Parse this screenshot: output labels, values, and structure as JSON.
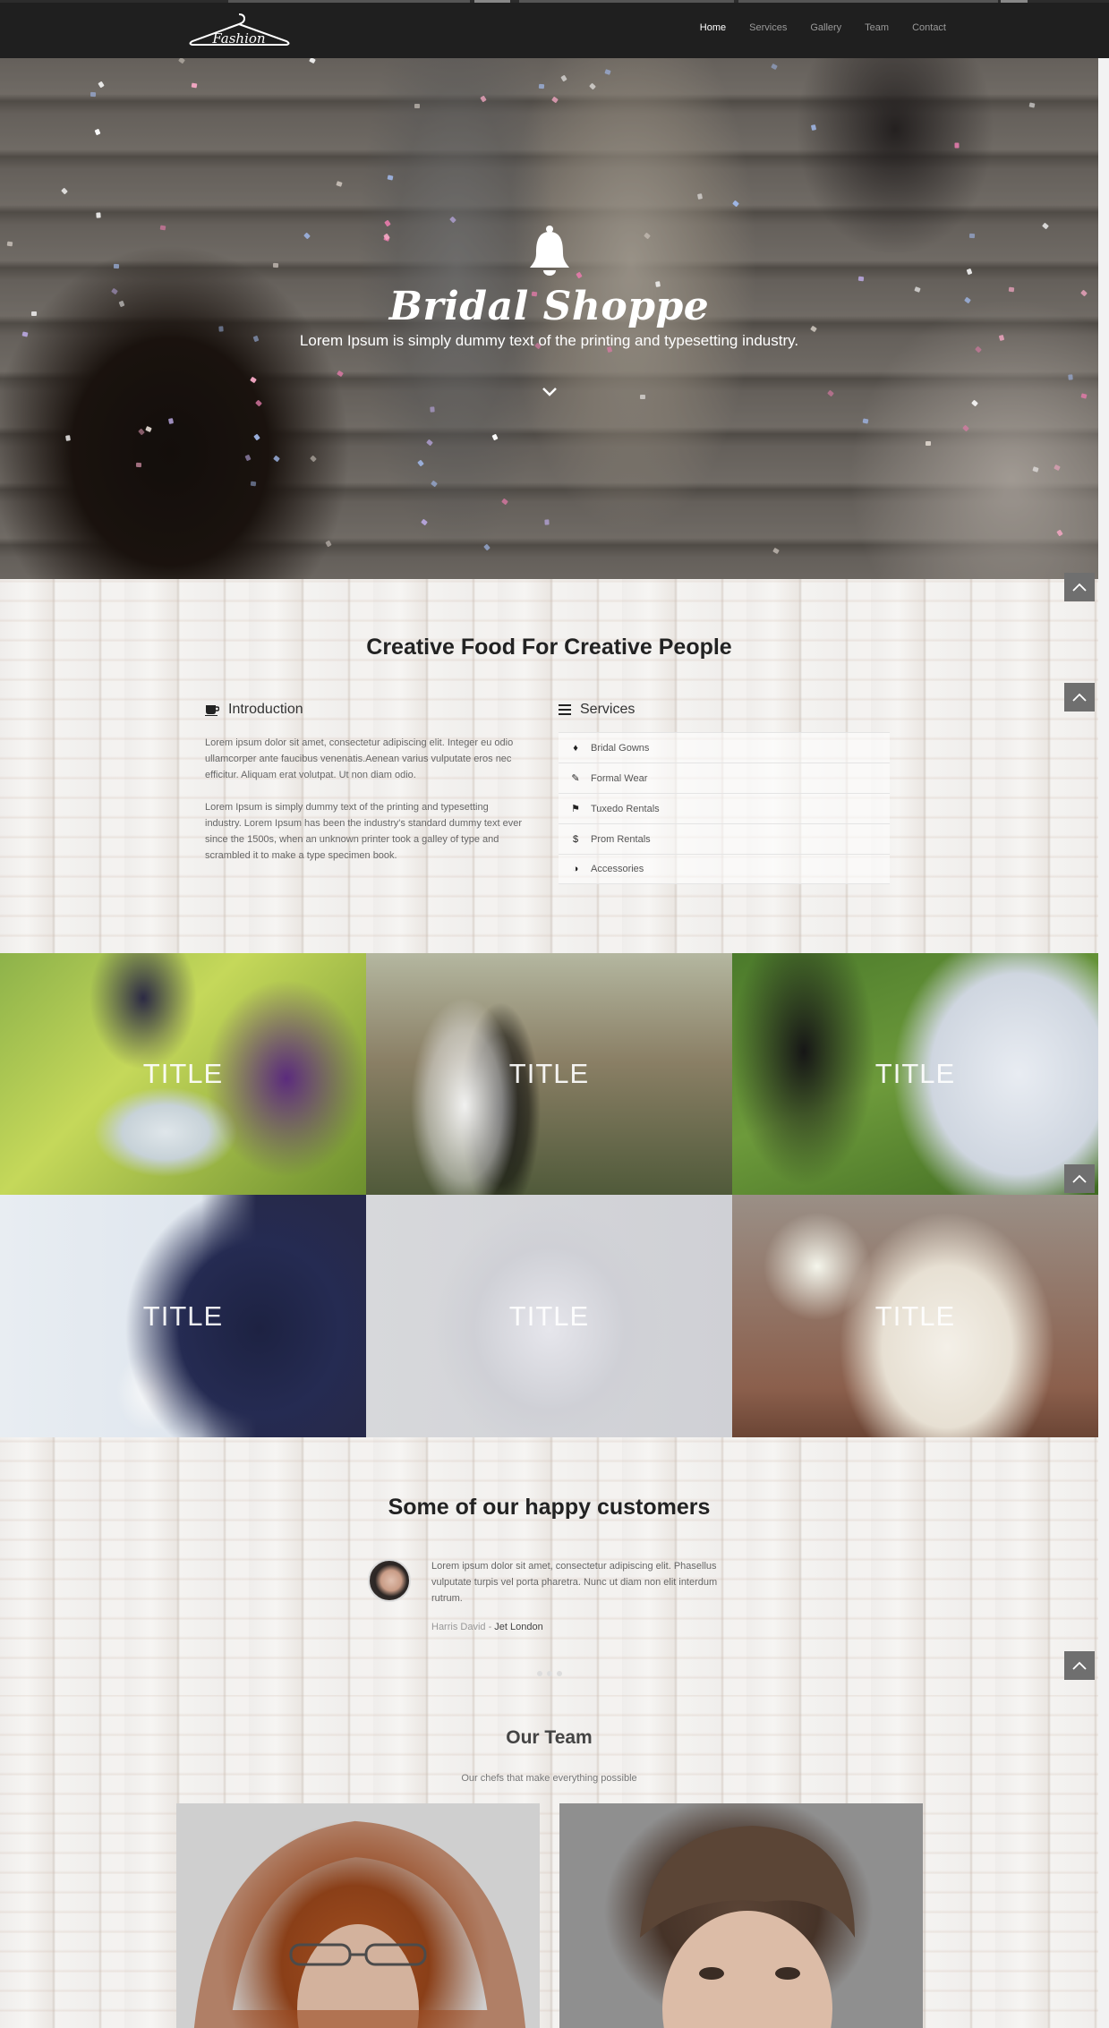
{
  "nav": {
    "logo_text": "Fashion",
    "items": [
      {
        "label": "Home",
        "active": true
      },
      {
        "label": "Services",
        "active": false
      },
      {
        "label": "Gallery",
        "active": false
      },
      {
        "label": "Team",
        "active": false
      },
      {
        "label": "Contact",
        "active": false
      }
    ]
  },
  "hero": {
    "icon": "bell-icon",
    "title": "Bridal Shoppe",
    "subtitle": "Lorem Ipsum is simply dummy text of the printing and typesetting industry.",
    "scroll_icon": "chevron-down-icon"
  },
  "about": {
    "title": "Creative Food For Creative People",
    "intro": {
      "heading": "Introduction",
      "icon": "coffee-cup-icon",
      "paragraph1": "Lorem ipsum dolor sit amet, consectetur adipiscing elit. Integer eu odio ullamcorper ante faucibus venenatis.Aenean varius vulputate eros nec efficitur. Aliquam erat volutpat. Ut non diam odio.",
      "paragraph2": "Lorem Ipsum is simply dummy text of the printing and typesetting industry. Lorem Ipsum has been the industry's standard dummy text ever since the 1500s, when an unknown printer took a galley of type and scrambled it to make a type specimen book."
    },
    "services": {
      "heading": "Services",
      "icon": "list-icon",
      "items": [
        {
          "label": "Bridal Gowns",
          "icon": "dress-icon"
        },
        {
          "label": "Formal Wear",
          "icon": "tie-icon"
        },
        {
          "label": "Tuxedo Rentals",
          "icon": "bookmark-icon"
        },
        {
          "label": "Prom Rentals",
          "icon": "dollar-icon"
        },
        {
          "label": "Accessories",
          "icon": "half-circle-icon"
        }
      ]
    }
  },
  "gallery": {
    "tiles": [
      {
        "title": "TITLE"
      },
      {
        "title": "TITLE"
      },
      {
        "title": "TITLE"
      },
      {
        "title": "TITLE"
      },
      {
        "title": "TITLE"
      },
      {
        "title": "TITLE"
      }
    ]
  },
  "customers": {
    "title": "Some of our happy customers",
    "quote": "Lorem ipsum dolor sit amet, consectetur adipiscing elit. Phasellus vulputate turpis vel porta pharetra. Nunc ut diam non elit interdum rutrum.",
    "author_name": "Harris David",
    "author_separator": " - ",
    "author_company": "Jet London"
  },
  "team": {
    "title": "Our Team",
    "subtitle": "Our chefs that make everything possible"
  },
  "colors": {
    "navbar": "#1f1f1f",
    "to_top_button": "#6f6f6f",
    "accent_white": "#ffffff"
  }
}
